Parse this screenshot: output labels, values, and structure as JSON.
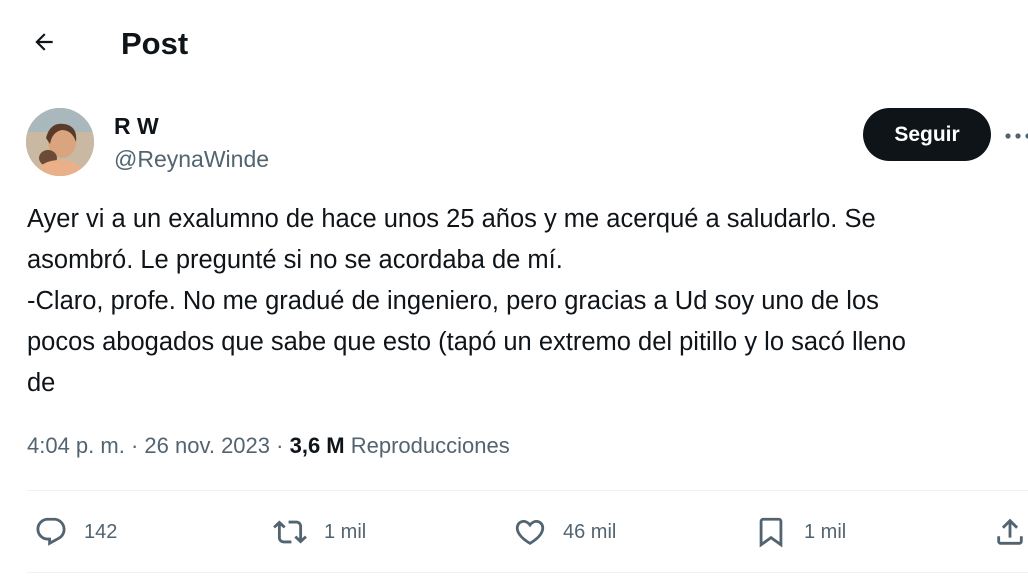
{
  "header": {
    "title": "Post"
  },
  "author": {
    "name": "R W",
    "handle": "@ReynaWinde",
    "follow_label": "Seguir"
  },
  "post": {
    "lines": [
      "Ayer vi a un exalumno de hace unos 25 años y me acerqué a saludarlo. Se",
      "asombró. Le pregunté si no se acordaba de mí.",
      "-Claro, profe. No me gradué de ingeniero, pero gracias a Ud soy uno de los",
      "pocos abogados que sabe que esto (tapó un extremo del pitillo y lo sacó lleno",
      "de"
    ]
  },
  "meta": {
    "time": "4:04 p. m.",
    "date": "26 nov. 2023",
    "separator": "·",
    "views_count": "3,6 M",
    "views_label": "Reproducciones"
  },
  "actions": {
    "replies": "142",
    "reposts": "1 mil",
    "likes": "46 mil",
    "bookmarks": "1 mil"
  },
  "icons": {
    "back": "arrow-left-icon",
    "more": "more-horizontal-icon",
    "reply": "reply-icon",
    "repost": "repost-icon",
    "like": "heart-icon",
    "bookmark": "bookmark-icon",
    "share": "share-icon"
  },
  "colors": {
    "text_primary": "#0f1419",
    "text_secondary": "#536471",
    "follow_button": "#0f1419",
    "divider": "#eff3f4"
  }
}
